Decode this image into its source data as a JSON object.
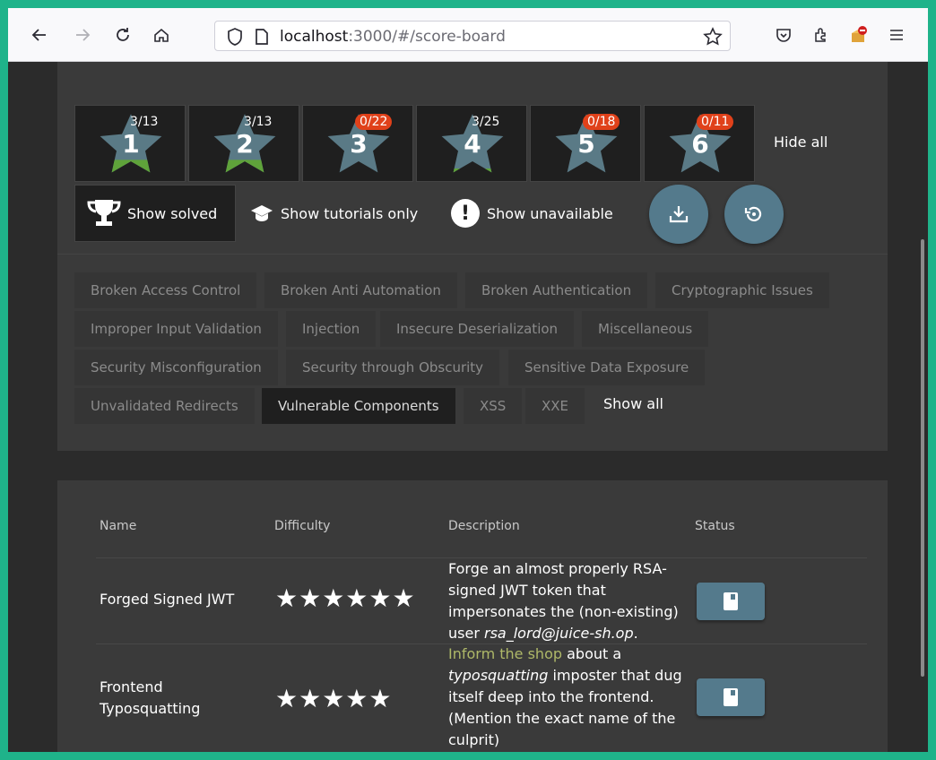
{
  "browser": {
    "url_host": "localhost",
    "url_rest": ":3000/#/score-board",
    "icons": [
      "back-icon",
      "forward-icon",
      "reload-icon",
      "home-icon",
      "shield-icon",
      "page-icon",
      "bookmark-star-icon",
      "pocket-icon",
      "extensions-icon",
      "addon-icon",
      "menu-icon"
    ]
  },
  "difficulty_tiles": [
    {
      "level": "1",
      "progress": "3/13"
    },
    {
      "level": "2",
      "progress": "3/13"
    },
    {
      "level": "3",
      "progress": "0/22"
    },
    {
      "level": "4",
      "progress": "3/25"
    },
    {
      "level": "5",
      "progress": "0/18"
    },
    {
      "level": "6",
      "progress": "0/11"
    }
  ],
  "hide_all": "Hide all",
  "filters": {
    "solved": "Show solved",
    "tutorials": "Show tutorials only",
    "unavailable": "Show unavailable"
  },
  "categories": [
    "Broken Access Control",
    "Broken Anti Automation",
    "Broken Authentication",
    "Cryptographic Issues",
    "Improper Input Validation",
    "Injection",
    "Insecure Deserialization",
    "Miscellaneous",
    "Security Misconfiguration",
    "Security through Obscurity",
    "Sensitive Data Exposure",
    "Unvalidated Redirects",
    "Vulnerable Components",
    "XSS",
    "XXE"
  ],
  "active_category": "Vulnerable Components",
  "show_all": "Show all",
  "table": {
    "headers": {
      "name": "Name",
      "difficulty": "Difficulty",
      "description": "Description",
      "status": "Status"
    },
    "rows": [
      {
        "name": "Forged Signed JWT",
        "stars": "★★★★★★",
        "desc_1": "Forge an almost properly RSA-signed JWT token that impersonates the (non-existing) user ",
        "desc_em": "rsa_lord@juice-sh.op",
        "desc_2": "."
      },
      {
        "name_1": "Frontend",
        "name_2": "Typosquatting",
        "stars": "★★★★★",
        "desc_link": "Inform the shop",
        "desc_1": " about a ",
        "desc_em": "typosquatting",
        "desc_2": " imposter that dug itself deep into the frontend. (Mention the exact name of the culprit)"
      }
    ]
  },
  "colors": {
    "accent": "#547a8c",
    "badge": "#e0411a",
    "star_fill": "#5a7a86",
    "star_progress": "#5fa33a",
    "link": "#aeb868"
  }
}
